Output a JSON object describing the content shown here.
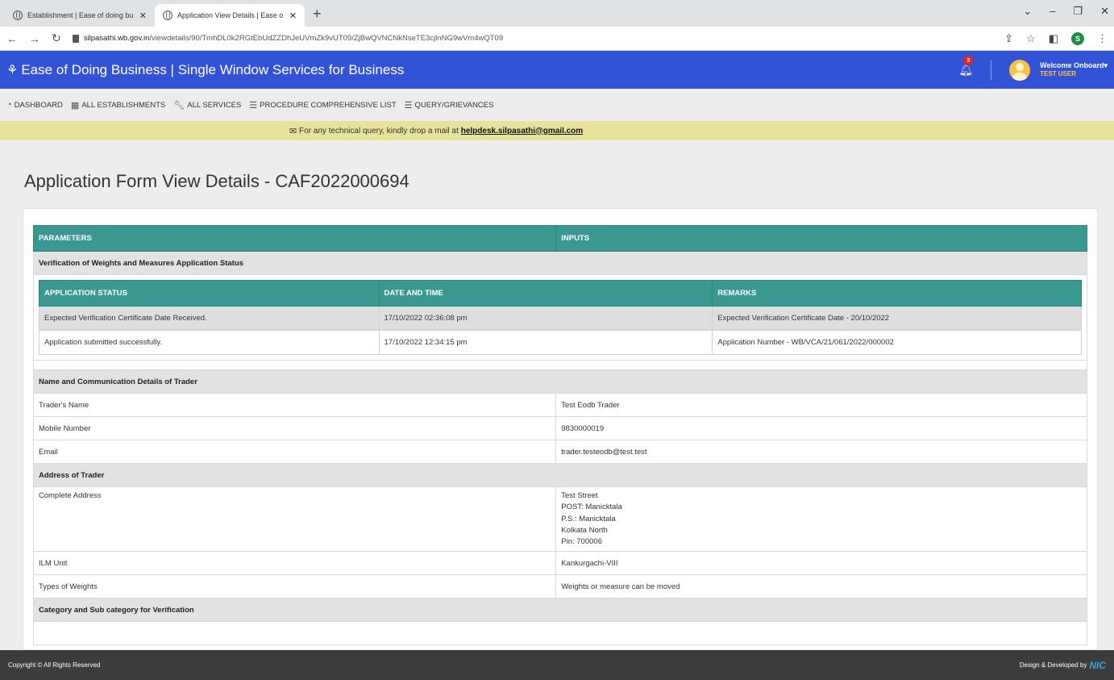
{
  "browser": {
    "tabs": [
      {
        "label": "Establishment | Ease of doing bu"
      },
      {
        "label": "Application View Details | Ease o"
      }
    ],
    "url_domain": "silpasathi.wb.gov.in",
    "url_path": "/viewdetails/90/TmhDL0k2RGtEbUdZZDhJeUVmZk9vUT09/ZjBwQVNCNkNseTE3cjlnNG9wVm4wQT09",
    "profile_initial": "S"
  },
  "header": {
    "brand": "Ease of Doing Business | Single Window Services for Business",
    "notif_count": "3",
    "welcome": "Welcome Onboard",
    "user": "TEST USER"
  },
  "menu": [
    {
      "label": "DASHBOARD"
    },
    {
      "label": "ALL ESTABLISHMENTS"
    },
    {
      "label": "ALL SERVICES"
    },
    {
      "label": "PROCEDURE COMPREHENSIVE LIST"
    },
    {
      "label": "QUERY/GRIEVANCES"
    }
  ],
  "notice": {
    "text": "For any technical query, kindly drop a mail at",
    "email": "helpdesk.silpasathi@gmail.com"
  },
  "page": {
    "title": "Application Form View Details - CAF2022000694"
  },
  "table": {
    "col1": "PARAMETERS",
    "col2": "INPUTS",
    "status_section": "Verification of Weights and Measures Application Status",
    "status_headers": [
      "APPLICATION STATUS",
      "DATE AND TIME",
      "REMARKS"
    ],
    "status_rows": [
      {
        "status": "Expected Verification Certificate Date Received.",
        "datetime": "17/10/2022 02:36:08 pm",
        "remarks": "Expected Verification Certificate Date - 20/10/2022"
      },
      {
        "status": "Application submitted successfully.",
        "datetime": "17/10/2022 12:34:15 pm",
        "remarks": "Application Number - WB/VCA/21/061/2022/000002"
      }
    ],
    "section_trader": "Name and Communication Details of Trader",
    "trader_name_label": "Trader's Name",
    "trader_name": "Test Eodb Trader",
    "mobile_label": "Mobile Number",
    "mobile": "9830000019",
    "email_label": "Email",
    "email": "trader.testeodb@test.test",
    "section_address": "Address of Trader",
    "address_label": "Complete Address",
    "address_lines": [
      "Test Street",
      "POST: Manicktala",
      "P.S.: Manicktala",
      "Kolkata North",
      "Pin: 700006"
    ],
    "ilm_label": "ILM Unit",
    "ilm": "Kankurgachi-VIII",
    "types_label": "Types of Weights",
    "types": "Weights or measure can be moved",
    "section_category": "Category and Sub category for Verification"
  },
  "footer": {
    "copyright": "Copyright © All Rights Reserved",
    "design": "Design & Developed by",
    "nic": "NIC"
  }
}
